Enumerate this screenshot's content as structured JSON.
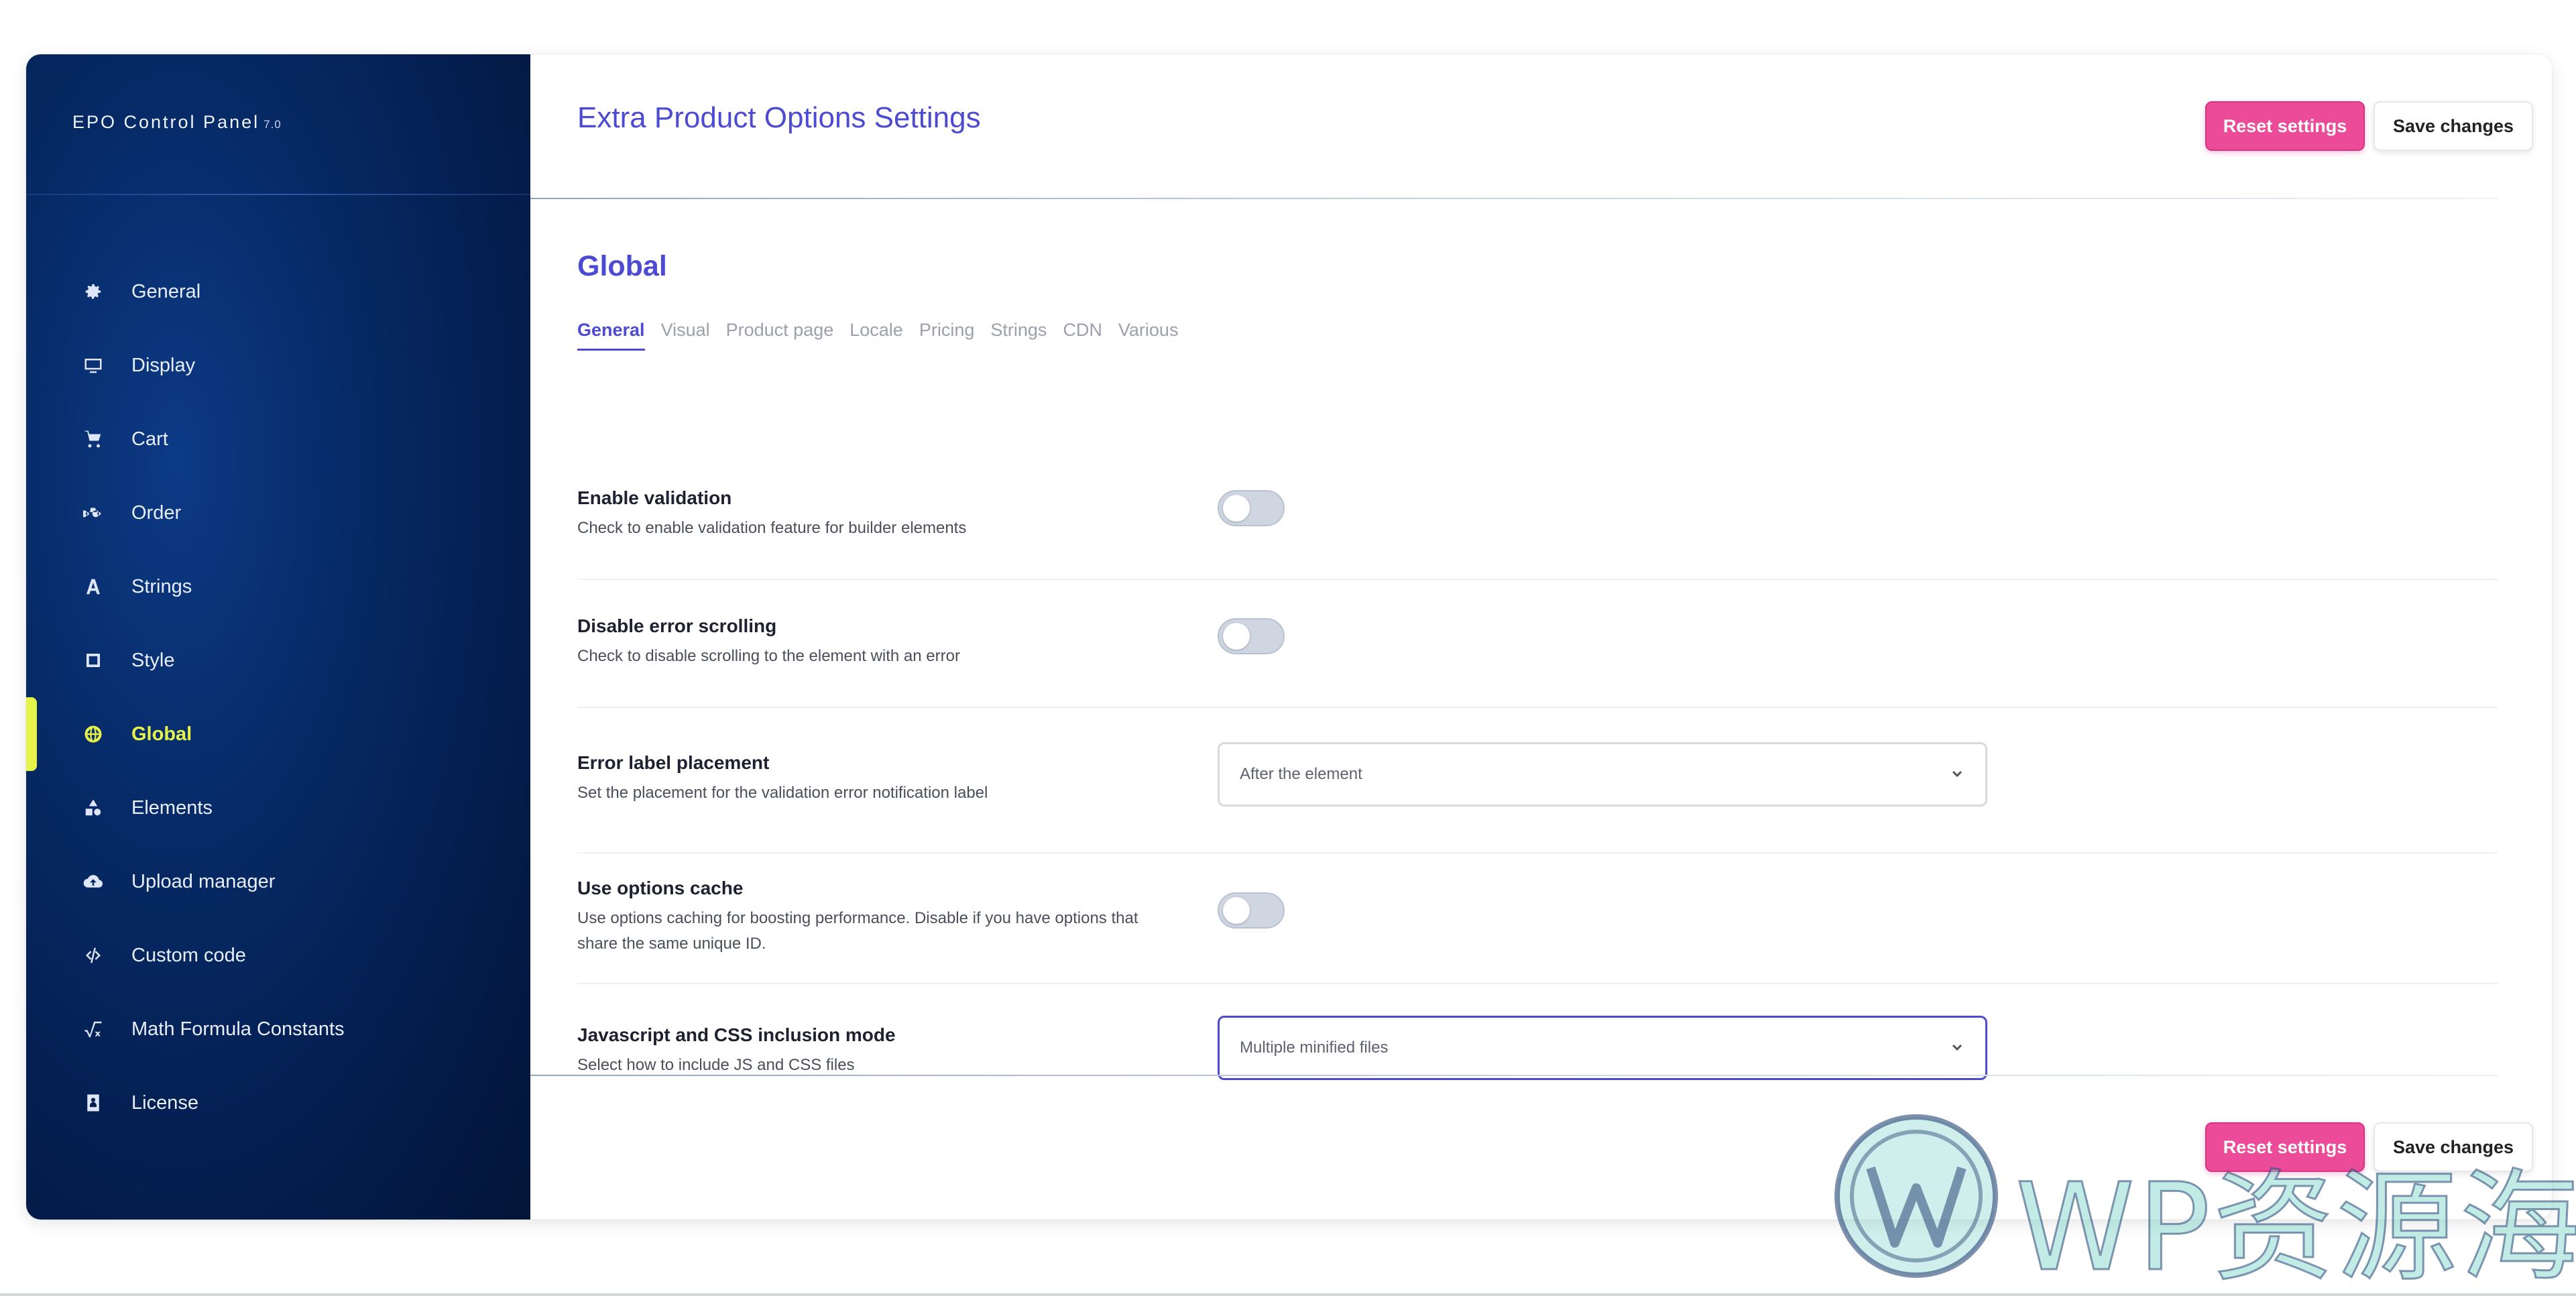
{
  "app": {
    "brand": "EPO Control Panel",
    "version": "7.0"
  },
  "sidebar": {
    "items": [
      {
        "label": "General",
        "icon": "gear-icon"
      },
      {
        "label": "Display",
        "icon": "monitor-icon"
      },
      {
        "label": "Cart",
        "icon": "cart-icon"
      },
      {
        "label": "Order",
        "icon": "truck-icon"
      },
      {
        "label": "Strings",
        "icon": "letter-a-icon"
      },
      {
        "label": "Style",
        "icon": "square-icon"
      },
      {
        "label": "Global",
        "icon": "globe-icon",
        "active": true
      },
      {
        "label": "Elements",
        "icon": "shapes-icon"
      },
      {
        "label": "Upload manager",
        "icon": "cloud-upload-icon"
      },
      {
        "label": "Custom code",
        "icon": "code-icon"
      },
      {
        "label": "Math Formula Constants",
        "icon": "square-root-icon"
      },
      {
        "label": "License",
        "icon": "id-badge-icon"
      }
    ],
    "active_color": "#e6f44a"
  },
  "header": {
    "title": "Extra Product Options Settings",
    "reset_label": "Reset settings",
    "save_label": "Save changes"
  },
  "footer": {
    "reset_label": "Reset settings",
    "save_label": "Save changes"
  },
  "section": {
    "title": "Global",
    "tabs": [
      {
        "label": "General",
        "active": true
      },
      {
        "label": "Visual"
      },
      {
        "label": "Product page"
      },
      {
        "label": "Locale"
      },
      {
        "label": "Pricing"
      },
      {
        "label": "Strings"
      },
      {
        "label": "CDN"
      },
      {
        "label": "Various"
      }
    ]
  },
  "settings": {
    "enable_validation": {
      "label": "Enable validation",
      "desc": "Check to enable validation feature for builder elements",
      "value": false
    },
    "disable_error_scrolling": {
      "label": "Disable error scrolling",
      "desc": "Check to disable scrolling to the element with an error",
      "value": false
    },
    "error_label_placement": {
      "label": "Error label placement",
      "desc": "Set the placement for the validation error notification label",
      "value": "After the element"
    },
    "use_options_cache": {
      "label": "Use options cache",
      "desc": "Use options caching for boosting performance. Disable if you have options that share the same unique ID.",
      "value": false
    },
    "js_css_inclusion_mode": {
      "label": "Javascript and CSS inclusion mode",
      "desc": "Select how to include JS and CSS files",
      "value": "Multiple minified files"
    }
  },
  "watermark": {
    "text": "WP资源海"
  },
  "colors": {
    "accent": "#4c4bd1",
    "reset_button": "#ec4b9a",
    "sidebar_bg": "#041d4d"
  }
}
